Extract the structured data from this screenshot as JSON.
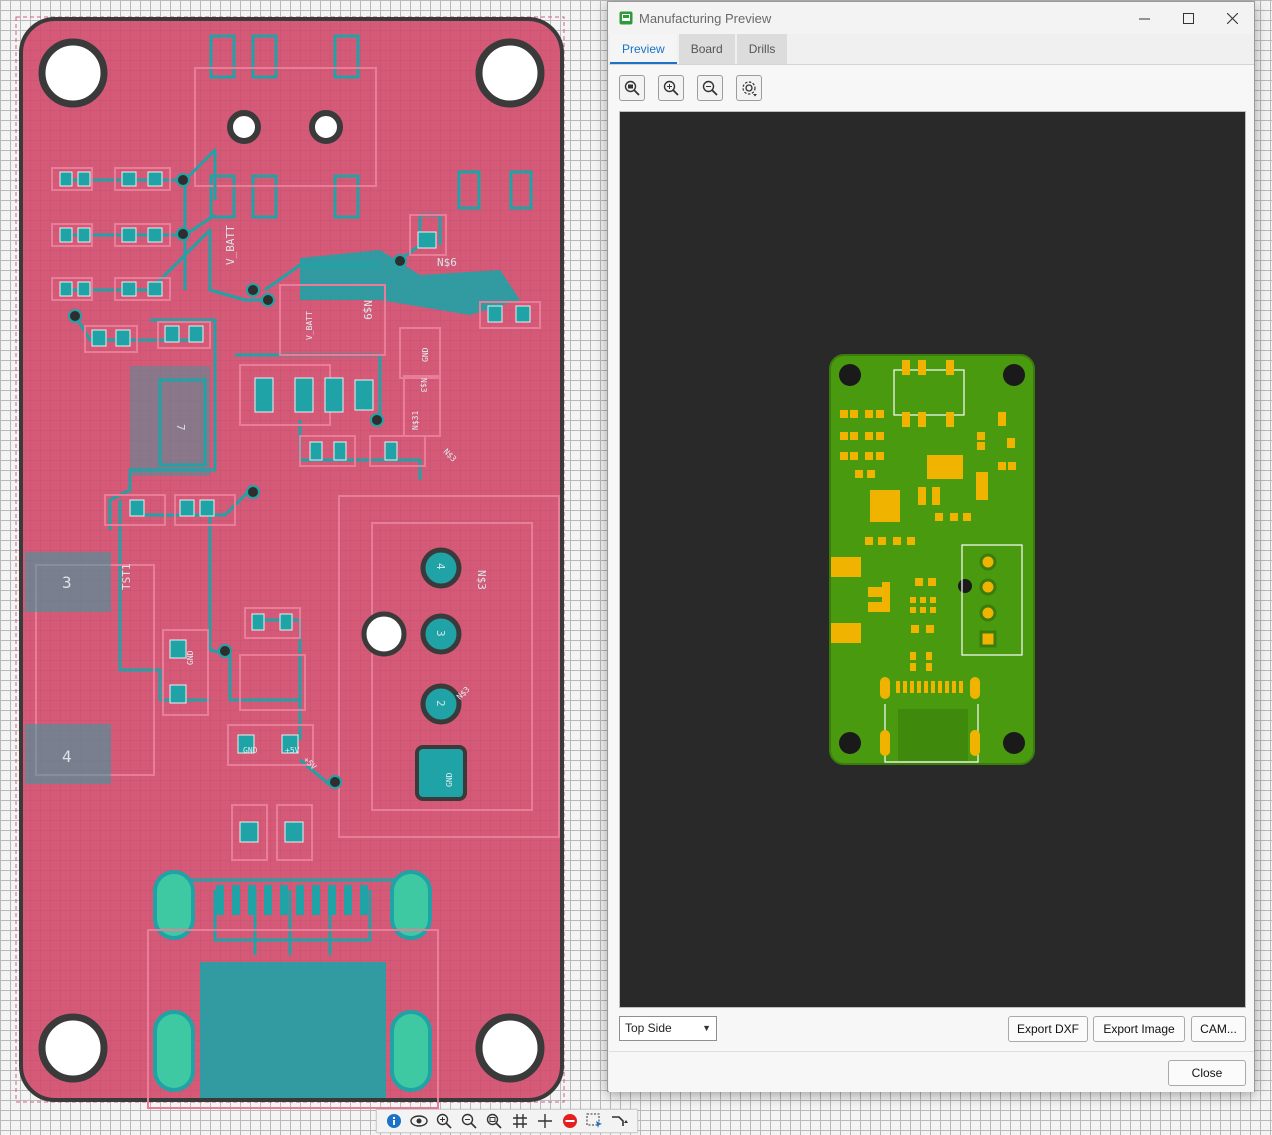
{
  "window": {
    "title": "Manufacturing Preview",
    "controls": {
      "minimize": "–",
      "maximize": "□",
      "close": "✕"
    }
  },
  "tabs": [
    {
      "label": "Preview",
      "active": true
    },
    {
      "label": "Board",
      "active": false
    },
    {
      "label": "Drills",
      "active": false
    }
  ],
  "preview_toolbar": {
    "icons": [
      "zoom-fit-icon",
      "zoom-in-icon",
      "zoom-out-icon",
      "settings-icon"
    ]
  },
  "footer": {
    "side_select": {
      "value": "Top Side"
    },
    "buttons": {
      "export_dxf": "Export DXF",
      "export_image": "Export Image",
      "cam": "CAM..."
    },
    "close": "Close"
  },
  "pcb_labels": {
    "v_batt": "V_BATT",
    "v_batt_2": "V_BATT",
    "ns6": "N$6",
    "ns9": "N$9",
    "ns3_a": "N$3",
    "ns3_b": "N$3",
    "ns3_c": "N$3",
    "ns3_d": "N$3",
    "ns31": "N$31",
    "tst1": "TST1",
    "gnd_a": "GND",
    "gnd_b": "GND",
    "gnd_c": "GND",
    "gnd_d": "GND",
    "plus5v_a": "+5V",
    "plus5v_b": "+5V",
    "pad_4_a": "4",
    "pad_3_a": "3",
    "pad_2": "2",
    "pad_3_b": "3",
    "pad_4_b": "4",
    "pad_7": "7"
  },
  "canvas_toolbar": {
    "icons": [
      "info-icon",
      "eye-icon",
      "zoom-in-icon",
      "zoom-out-icon",
      "zoom-fit-icon",
      "grid-icon",
      "crosshair-icon",
      "stop-icon",
      "select-icon",
      "route-icon"
    ]
  },
  "colors": {
    "board_fill": "#d45a78",
    "copper_teal": "#1fa3a6",
    "preview_board": "#4a9a10",
    "preview_pad": "#f0b400",
    "accent": "#1a73c6"
  }
}
